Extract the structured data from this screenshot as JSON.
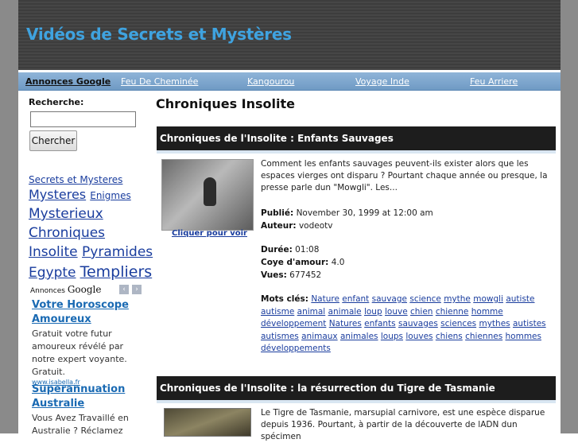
{
  "header": {
    "title": "Vidéos de Secrets et Mystères"
  },
  "nav": {
    "ads_label": "Annonces Google",
    "links": [
      "Feu De Cheminée",
      "Kangourou",
      "Voyage Inde",
      "Feu Arriere"
    ]
  },
  "sidebar": {
    "search_label": "Recherche:",
    "search_button": "Chercher",
    "tags": [
      "Secrets et Mysteres",
      "Mysteres",
      "Enigmes",
      "Mysterieux",
      "Chroniques",
      "Insolite",
      "Pyramides",
      "Egypte",
      "Templiers"
    ],
    "ads_label": "Annonces",
    "ads_brand": "Google",
    "ads": [
      {
        "title": "Votre Horoscope Amoureux",
        "text": "Gratuit votre futur amoureux révélé par notre expert voyante. Gratuit.",
        "url": "www.isabella.fr"
      },
      {
        "title": "Superannuation Australie",
        "text": "Vous Avez Travaillé en Australie ? Réclamez",
        "url": ""
      }
    ],
    "arrow_left": "‹",
    "arrow_right": "›"
  },
  "main": {
    "title": "Chroniques Insolite",
    "videos": [
      {
        "heading": "Chroniques de l'Insolite : Enfants Sauvages",
        "watch": "Cliquer pour voir",
        "description": "Comment les enfants sauvages peuvent-ils exister alors que les espaces vierges ont disparu ? Pourtant chaque année ou presque, la presse parle dun \"Mowgli\". Les...",
        "published_label": "Publié:",
        "published": "November 30, 1999 at 12:00 am",
        "author_label": "Auteur:",
        "author": "vodeotv",
        "duration_label": "Durée:",
        "duration": "01:08",
        "rating_label": "Coye d'amour:",
        "rating": "4.0",
        "views_label": "Vues:",
        "views": "677452",
        "keywords_label": "Mots clés:",
        "keywords": [
          "Nature",
          "enfant",
          "sauvage",
          "science",
          "mythe",
          "mowgli",
          "autiste",
          "autisme",
          "animal",
          "animale",
          "loup",
          "louve",
          "chien",
          "chienne",
          "homme",
          "développement",
          "Natures",
          "enfants",
          "sauvages",
          "sciences",
          "mythes",
          "autistes",
          "autismes",
          "animaux",
          "animales",
          "loups",
          "louves",
          "chiens",
          "chiennes",
          "hommes",
          "développements"
        ]
      },
      {
        "heading": "Chroniques de l'Insolite : la résurrection du Tigre de Tasmanie",
        "description": "Le Tigre de Tasmanie, marsupial carnivore, est une espèce disparue depuis 1936. Pourtant, à partir de la découverte de lADN dun spécimen"
      }
    ]
  }
}
